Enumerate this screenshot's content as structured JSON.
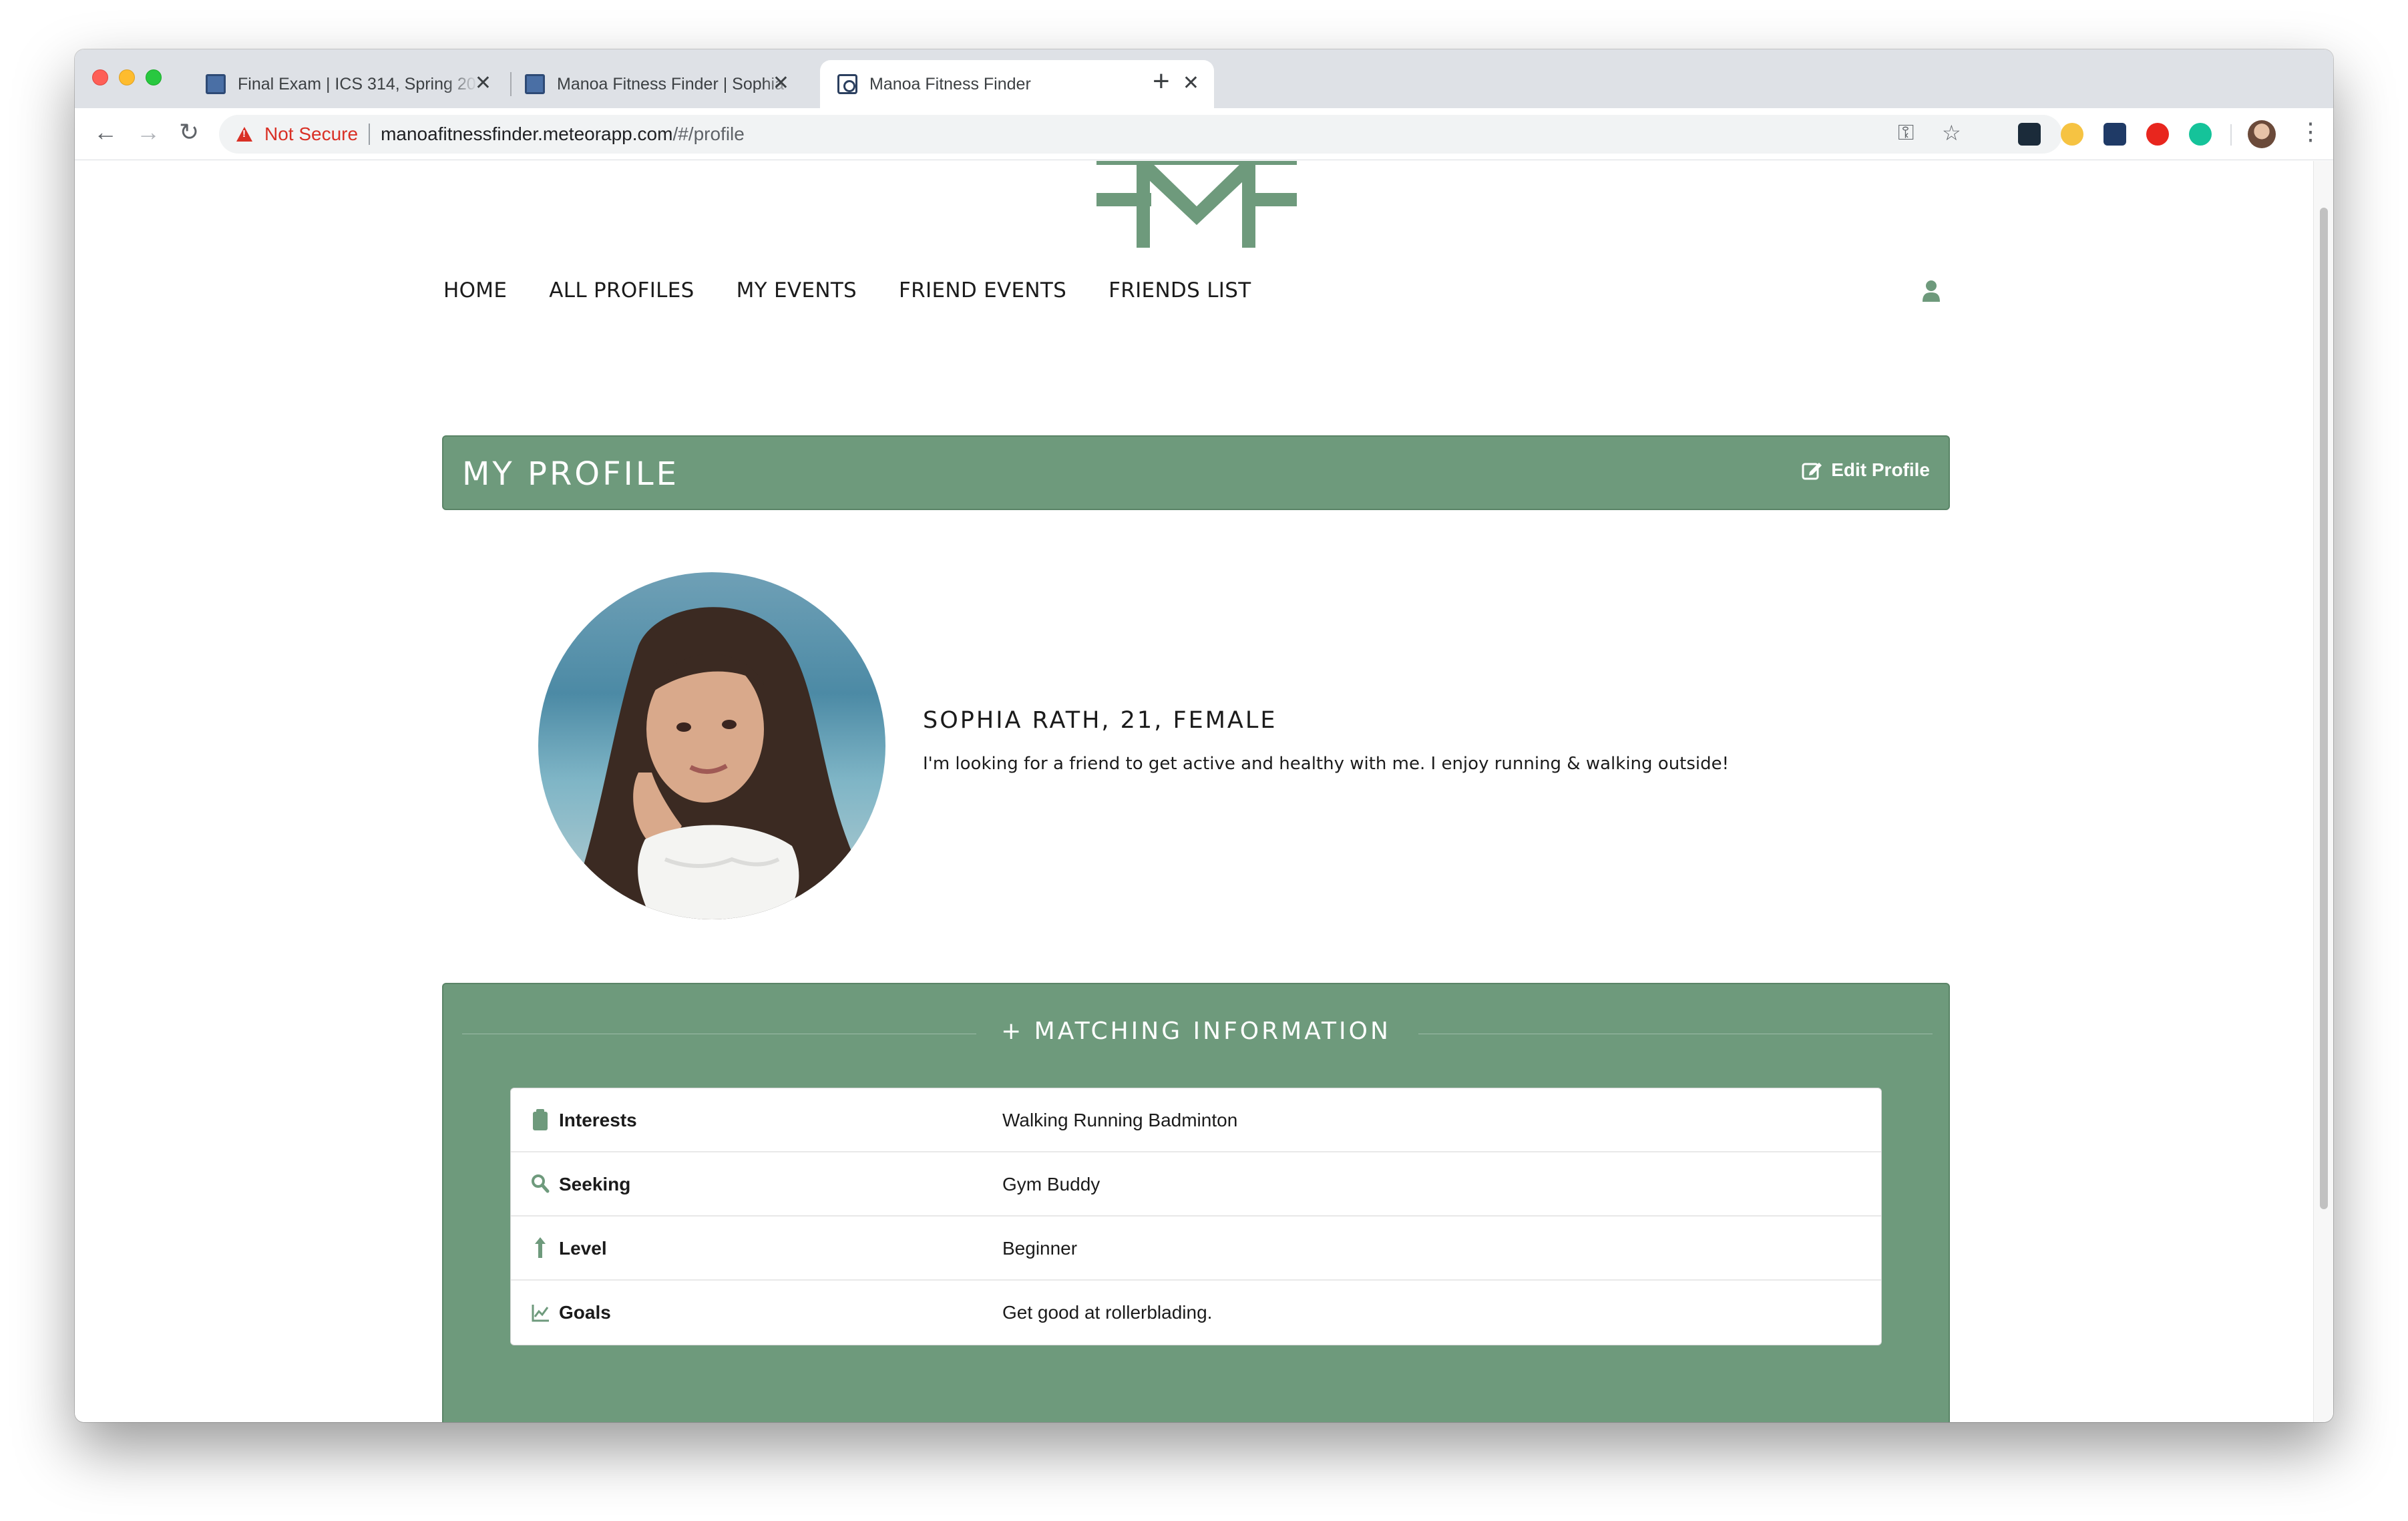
{
  "browser": {
    "tabs": [
      {
        "title": "Final Exam | ICS 314, Spring 20",
        "active": false
      },
      {
        "title": "Manoa Fitness Finder | Sophia",
        "active": false
      },
      {
        "title": "Manoa Fitness Finder",
        "active": true
      }
    ],
    "security_label": "Not Secure",
    "url_host": "manoafitnessfinder.meteorapp.com",
    "url_path": "/#/profile",
    "close_glyph": "✕",
    "newtab_glyph": "+",
    "icons": {
      "back": "←",
      "forward": "→",
      "reload": "↻",
      "key": "⚿",
      "star": "☆",
      "menu": "⋮"
    }
  },
  "site": {
    "nav": [
      "HOME",
      "ALL PROFILES",
      "MY EVENTS",
      "FRIEND EVENTS",
      "FRIENDS LIST"
    ],
    "accent_color": "#6e9a7c"
  },
  "profile": {
    "header_title": "MY PROFILE",
    "edit_label": "Edit Profile",
    "name_line": "SOPHIA RATH, 21, FEMALE",
    "bio": "I'm looking for a friend to get active and healthy with me. I enjoy running & walking outside!"
  },
  "matching": {
    "heading": "+ MATCHING INFORMATION",
    "rows": [
      {
        "icon": "clipboard-icon",
        "label": "Interests",
        "value": "Walking Running Badminton"
      },
      {
        "icon": "search-icon",
        "label": "Seeking",
        "value": "Gym Buddy"
      },
      {
        "icon": "level-up-icon",
        "label": "Level",
        "value": "Beginner"
      },
      {
        "icon": "line-chart-icon",
        "label": "Goals",
        "value": "Get good at rollerblading."
      }
    ]
  }
}
